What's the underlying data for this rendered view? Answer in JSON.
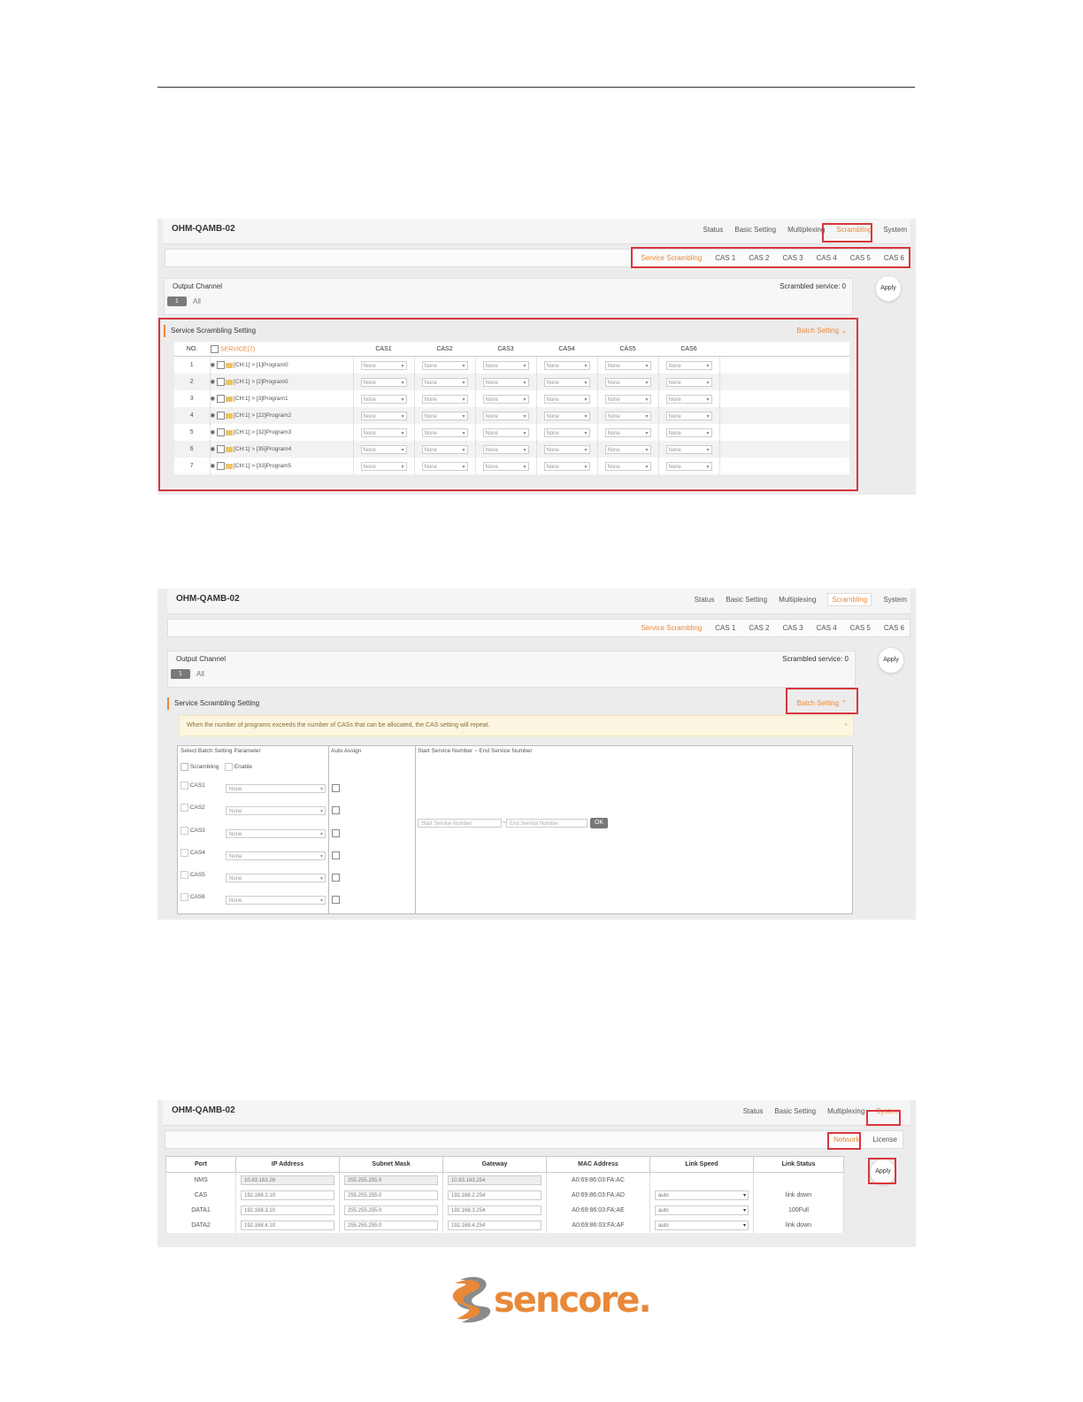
{
  "device": "OHM-QAMB-02",
  "main_nav": [
    "Status",
    "Basic Setting",
    "Multiplexing",
    "Scrambling",
    "System"
  ],
  "sub_nav": [
    "Service Scrambling",
    "CAS 1",
    "CAS 2",
    "CAS 3",
    "CAS 4",
    "CAS 5",
    "CAS 6"
  ],
  "output_channel": {
    "label": "Output Channel",
    "chip": "1",
    "all": "All",
    "scrambled": "Scrambled service: 0"
  },
  "apply": "Apply",
  "section_title": "Service Scrambling Setting",
  "batch_setting": "Batch Setting",
  "table": {
    "headers": [
      "NO.",
      "SERVICE(7)",
      "CAS1",
      "CAS2",
      "CAS3",
      "CAS4",
      "CAS5",
      "CAS6"
    ],
    "none": "None",
    "rows": [
      {
        "no": "1",
        "service": "[CH:1] > [1]Program0"
      },
      {
        "no": "2",
        "service": "[CH:1] > [2]Program0"
      },
      {
        "no": "3",
        "service": "[CH:1] > [3]Program1"
      },
      {
        "no": "4",
        "service": "[CH:1] > [22]Program2"
      },
      {
        "no": "5",
        "service": "[CH:1] > [32]Program3"
      },
      {
        "no": "6",
        "service": "[CH:1] > [35]Program4"
      },
      {
        "no": "7",
        "service": "[CH:1] > [33]Program5"
      }
    ]
  },
  "batch": {
    "notice": "When the number of programs exceeds the number of CASs that can be allocated, the CAS setting will repeat.",
    "close": "×",
    "col1": "Select Batch Setting Parameter",
    "col2": "Auto Assign",
    "col3": "Start Service Number ~ End Service Number",
    "scrambling": "Scrambling",
    "enable": "Enable",
    "cas": [
      "CAS1",
      "CAS2",
      "CAS3",
      "CAS4",
      "CAS5",
      "CAS6"
    ],
    "none": "None",
    "start_placeholder": "Start Service Number",
    "tilde": "~",
    "end_placeholder": "End Service Number",
    "ok": "OK"
  },
  "system_nav": [
    "Status",
    "Basic Setting",
    "Multiplexing",
    "System"
  ],
  "system_sub": [
    "Network",
    "License"
  ],
  "network": {
    "headers": [
      "Port",
      "IP Address",
      "Subnet Mask",
      "Gateway",
      "MAC Address",
      "Link Speed",
      "Link Status"
    ],
    "rows": [
      {
        "port": "NMS",
        "ip": "10.83.163.26",
        "mask": "255.255.255.0",
        "gw": "10.83.163.254",
        "mac": "A0:69:86:03:FA:AC",
        "speed": "",
        "status": ""
      },
      {
        "port": "CAS",
        "ip": "192.168.2.10",
        "mask": "255.255.255.0",
        "gw": "192.168.2.254",
        "mac": "A0:69:86:03:FA:AD",
        "speed": "auto",
        "status": "link down"
      },
      {
        "port": "DATA1",
        "ip": "192.168.3.10",
        "mask": "255.255.255.0",
        "gw": "192.168.3.254",
        "mac": "A0:69:86:03:FA:AE",
        "speed": "auto",
        "status": "100Full"
      },
      {
        "port": "DATA2",
        "ip": "192.168.4.10",
        "mask": "255.255.255.0",
        "gw": "192.168.4.254",
        "mac": "A0:69:86:03:FA:AF",
        "speed": "auto",
        "status": "link down"
      }
    ]
  },
  "logo_text": "sencore.",
  "colors": {
    "accent": "#e8893a",
    "highlight": "#d9363e",
    "logo_gray": "#8a8a8a"
  }
}
